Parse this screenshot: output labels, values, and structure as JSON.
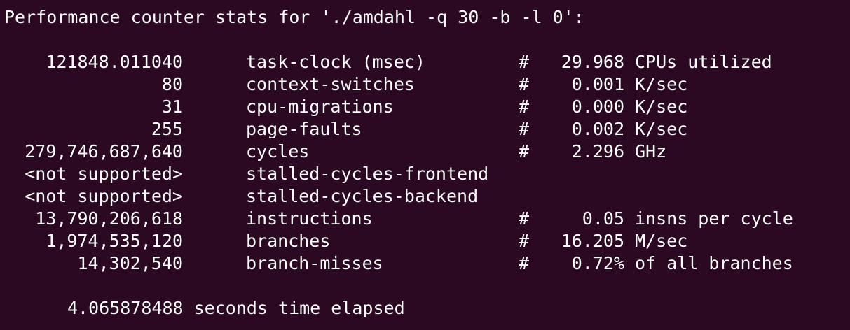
{
  "terminal": {
    "background": "#2c0922",
    "foreground": "#ffffff",
    "header": "Performance counter stats for './amdahl -q 30 -b -l 0':",
    "rows": [
      {
        "value": "121848.011040",
        "event": "task-clock (msec)",
        "hash": "#",
        "metric": "29.968",
        "unit": "CPUs utilized"
      },
      {
        "value": "80",
        "event": "context-switches",
        "hash": "#",
        "metric": "0.001",
        "unit": "K/sec"
      },
      {
        "value": "31",
        "event": "cpu-migrations",
        "hash": "#",
        "metric": "0.000",
        "unit": "K/sec"
      },
      {
        "value": "255",
        "event": "page-faults",
        "hash": "#",
        "metric": "0.002",
        "unit": "K/sec"
      },
      {
        "value": "279,746,687,640",
        "event": "cycles",
        "hash": "#",
        "metric": "2.296",
        "unit": "GHz"
      },
      {
        "value": "<not supported>",
        "event": "stalled-cycles-frontend",
        "hash": "",
        "metric": "",
        "unit": ""
      },
      {
        "value": "<not supported>",
        "event": "stalled-cycles-backend",
        "hash": "",
        "metric": "",
        "unit": ""
      },
      {
        "value": "13,790,206,618",
        "event": "instructions",
        "hash": "#",
        "metric": "0.05",
        "unit": "insns per cycle"
      },
      {
        "value": "1,974,535,120",
        "event": "branches",
        "hash": "#",
        "metric": "16.205",
        "unit": "M/sec"
      },
      {
        "value": "14,302,540",
        "event": "branch-misses",
        "hash": "#",
        "metric": "0.72%",
        "unit": "of all branches"
      }
    ],
    "elapsed": "4.065878488 seconds time elapsed"
  }
}
